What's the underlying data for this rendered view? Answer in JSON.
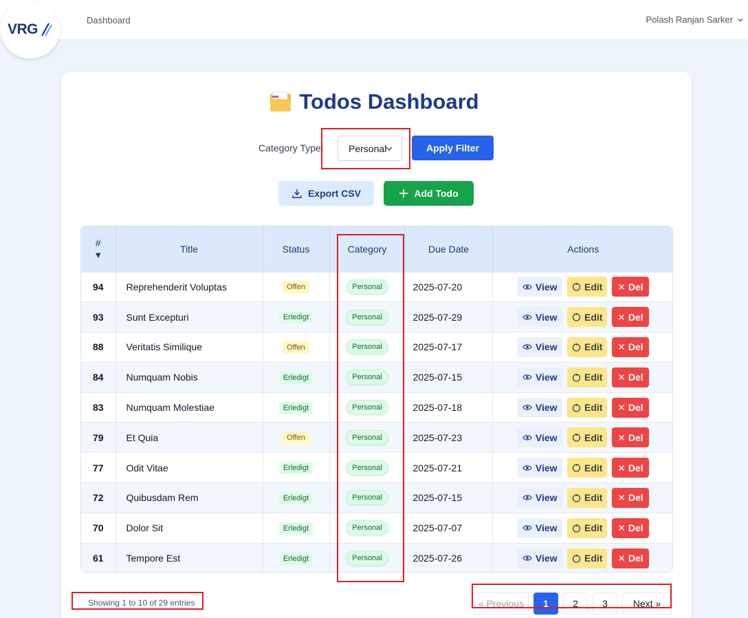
{
  "logo": {
    "text": "VRG"
  },
  "nav": {
    "dashboard": "Dashboard"
  },
  "user": {
    "name": "Polash Ranjan Sarker"
  },
  "page": {
    "title": "Todos Dashboard"
  },
  "filter": {
    "label": "Category Type:",
    "selected": "Personal",
    "apply_label": "Apply Filter"
  },
  "actions": {
    "export_label": "Export CSV",
    "add_label": "Add Todo"
  },
  "table": {
    "headers": {
      "id": "#",
      "title": "Title",
      "status": "Status",
      "category": "Category",
      "due": "Due Date",
      "actions": "Actions"
    },
    "sort_indicator": "▼",
    "row_actions": {
      "view": "View",
      "edit": "Edit",
      "delete": "Del"
    },
    "rows": [
      {
        "id": "94",
        "title": "Reprehenderit Voluptas",
        "status": "Offen",
        "category": "Personal",
        "due": "2025-07-20"
      },
      {
        "id": "93",
        "title": "Sunt Excepturi",
        "status": "Erledigt",
        "category": "Personal",
        "due": "2025-07-29"
      },
      {
        "id": "88",
        "title": "Veritatis Similique",
        "status": "Offen",
        "category": "Personal",
        "due": "2025-07-17"
      },
      {
        "id": "84",
        "title": "Numquam Nobis",
        "status": "Erledigt",
        "category": "Personal",
        "due": "2025-07-15"
      },
      {
        "id": "83",
        "title": "Numquam Molestiae",
        "status": "Erledigt",
        "category": "Personal",
        "due": "2025-07-18"
      },
      {
        "id": "79",
        "title": "Et Quia",
        "status": "Offen",
        "category": "Personal",
        "due": "2025-07-23"
      },
      {
        "id": "77",
        "title": "Odit Vitae",
        "status": "Erledigt",
        "category": "Personal",
        "due": "2025-07-21"
      },
      {
        "id": "72",
        "title": "Quibusdam Rem",
        "status": "Erledigt",
        "category": "Personal",
        "due": "2025-07-15"
      },
      {
        "id": "70",
        "title": "Dolor Sit",
        "status": "Erledigt",
        "category": "Personal",
        "due": "2025-07-07"
      },
      {
        "id": "61",
        "title": "Tempore Est",
        "status": "Erledigt",
        "category": "Personal",
        "due": "2025-07-26"
      }
    ]
  },
  "pagination": {
    "info": "Showing 1 to 10 of 29 entries",
    "previous": "« Previous",
    "pages": [
      "1",
      "2",
      "3"
    ],
    "active_page": "1",
    "next": "Next »"
  },
  "colors": {
    "primary": "#2563eb",
    "success": "#16a34a",
    "danger": "#ef4444",
    "warning": "#fde68a",
    "title": "#1e3a8a",
    "highlight": "#e11d24"
  }
}
